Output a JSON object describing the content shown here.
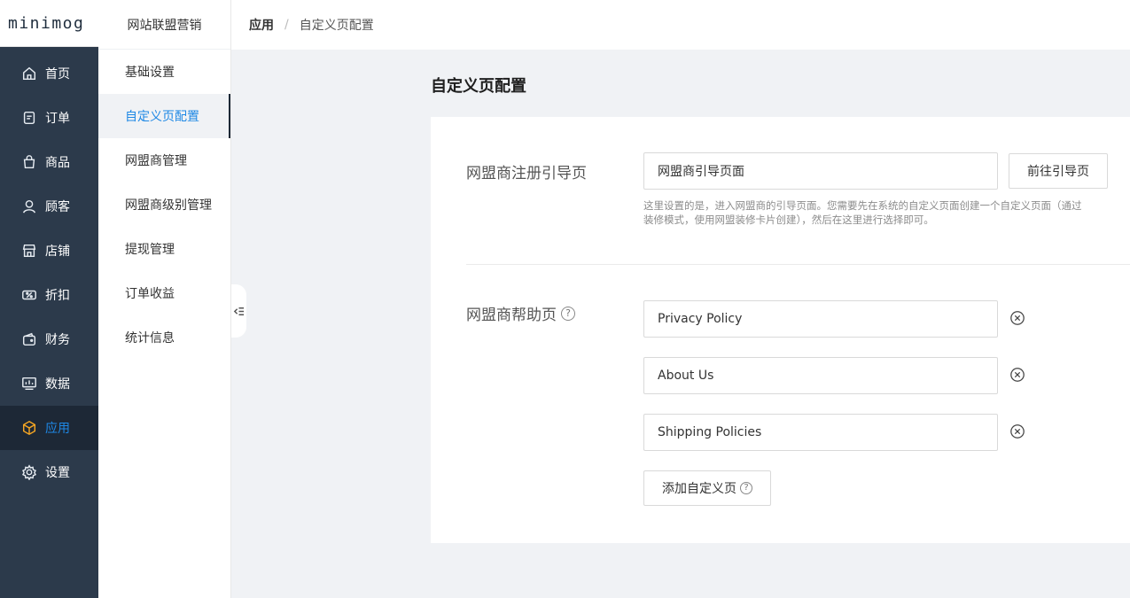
{
  "logo": {
    "text": "minimog"
  },
  "sidebar": {
    "items": [
      {
        "label": "首页",
        "icon": "home-icon"
      },
      {
        "label": "订单",
        "icon": "order-icon"
      },
      {
        "label": "商品",
        "icon": "bag-icon"
      },
      {
        "label": "顾客",
        "icon": "user-icon"
      },
      {
        "label": "店铺",
        "icon": "store-icon"
      },
      {
        "label": "折扣",
        "icon": "discount-icon"
      },
      {
        "label": "财务",
        "icon": "wallet-icon"
      },
      {
        "label": "数据",
        "icon": "chart-icon"
      },
      {
        "label": "应用",
        "icon": "cube-icon",
        "active": true
      },
      {
        "label": "设置",
        "icon": "gear-icon"
      }
    ]
  },
  "submenu": {
    "title": "网站联盟营销",
    "items": [
      {
        "label": "基础设置"
      },
      {
        "label": "自定义页配置",
        "active": true
      },
      {
        "label": "网盟商管理"
      },
      {
        "label": "网盟商级别管理"
      },
      {
        "label": "提现管理"
      },
      {
        "label": "订单收益"
      },
      {
        "label": "统计信息"
      }
    ]
  },
  "breadcrumb": {
    "parent": "应用",
    "separator": "/",
    "current": "自定义页配置"
  },
  "page": {
    "title": "自定义页配置",
    "register": {
      "label": "网盟商注册引导页",
      "value": "网盟商引导页面",
      "button": "前往引导页",
      "hint": "这里设置的是，进入网盟商的引导页面。您需要先在系统的自定义页面创建一个自定义页面（通过装修模式，使用网盟装修卡片创建），然后在这里进行选择即可。"
    },
    "help": {
      "label": "网盟商帮助页",
      "help_glyph": "?",
      "pages": [
        {
          "value": "Privacy Policy"
        },
        {
          "value": "About Us"
        },
        {
          "value": "Shipping Policies"
        }
      ],
      "add_button": "添加自定义页",
      "add_help_glyph": "?"
    }
  },
  "colors": {
    "accent": "#1e88e5",
    "sidebar_bg": "#2c3a4b",
    "active_icon": "#f5a623"
  }
}
